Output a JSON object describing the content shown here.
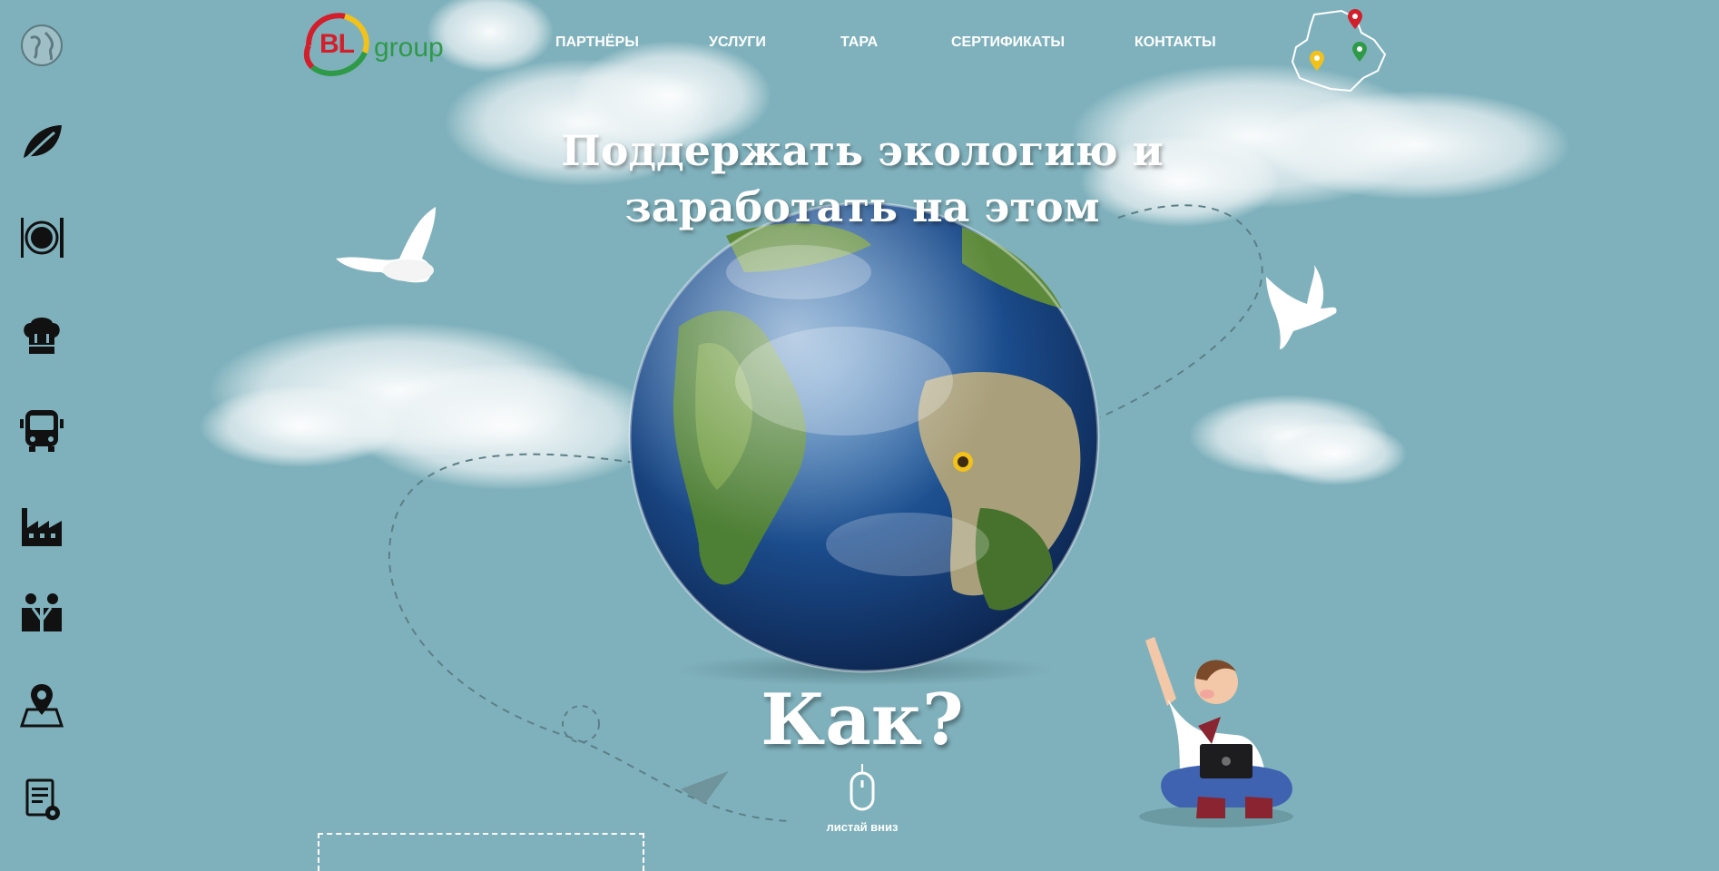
{
  "brand": {
    "logo_mark": "BL",
    "logo_word": "group"
  },
  "nav": [
    {
      "label": "ПАРТНЁРЫ"
    },
    {
      "label": "УСЛУГИ"
    },
    {
      "label": "ТАРА"
    },
    {
      "label": "СЕРТИФИКАТЫ"
    },
    {
      "label": "КОНТАКТЫ"
    }
  ],
  "hero": {
    "line1": "Поддержать экологию и",
    "line2": "заработать на этом",
    "question": "Как?",
    "scroll_label": "листай вниз"
  },
  "sidebar_icons": [
    "globe-icon",
    "leaf-icon",
    "dining-icon",
    "chef-hat-icon",
    "bus-icon",
    "factory-icon",
    "partners-icon",
    "map-pin-icon",
    "certificate-icon"
  ],
  "colors": {
    "background": "#7fb1bc",
    "brand_red": "#d21f2b",
    "brand_green": "#2e9a48",
    "brand_yellow": "#f2c21b"
  }
}
